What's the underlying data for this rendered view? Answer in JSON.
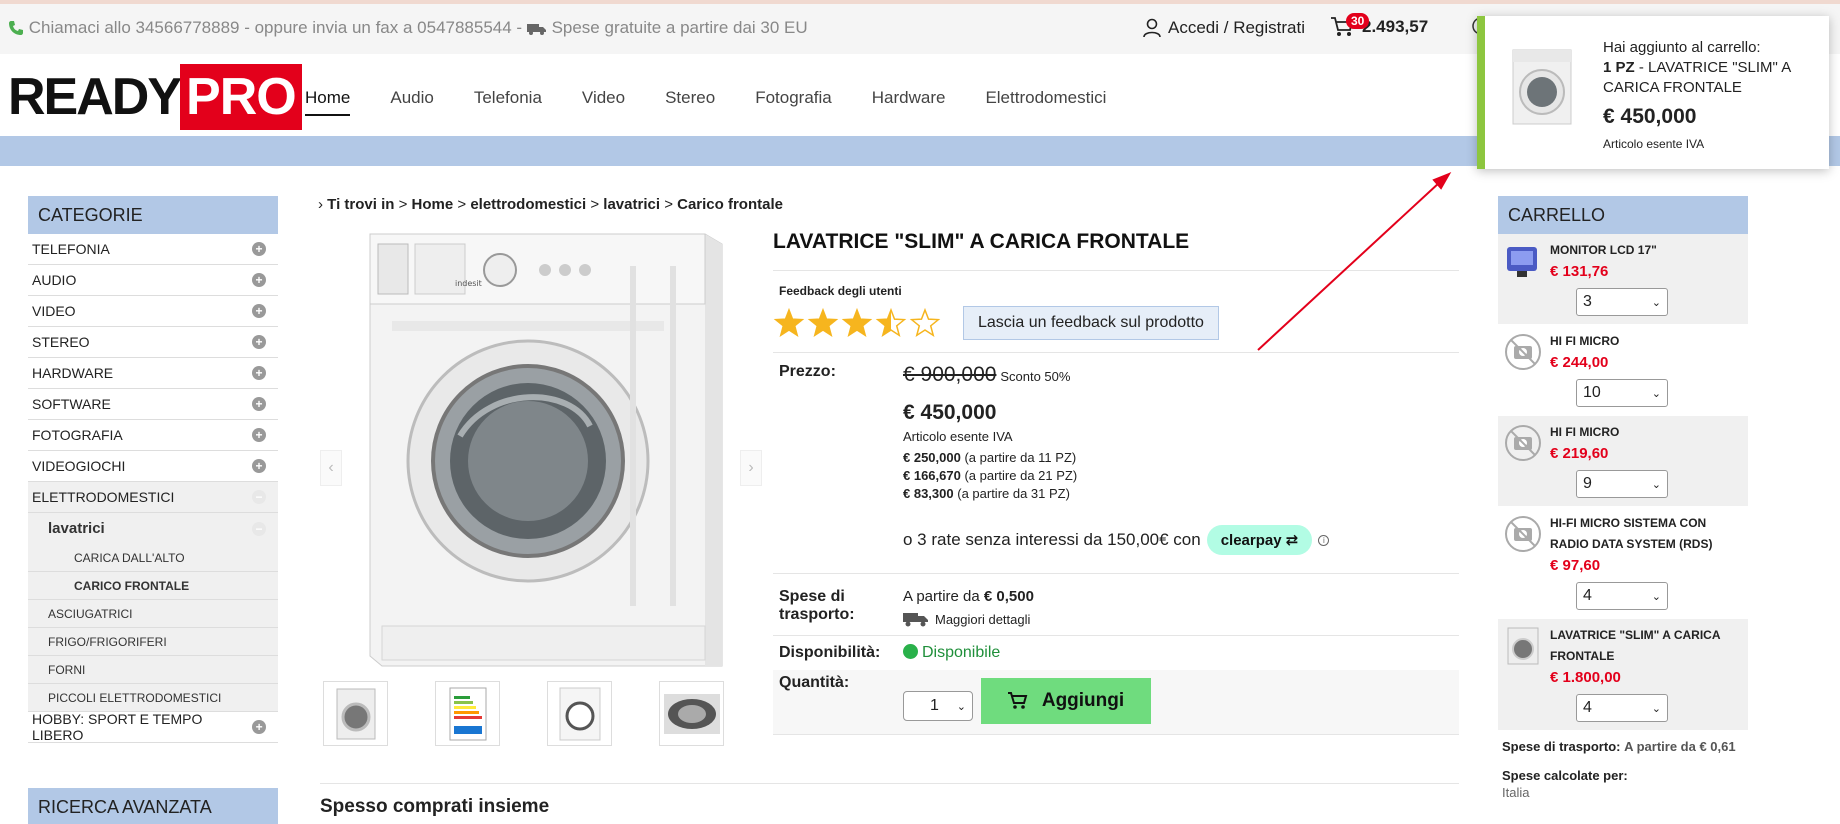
{
  "topbar": {
    "contact": "Chiamaci allo 34566778889 - oppure invia un fax a 0547885544 -",
    "shipping_free": "Spese gratuite a partire dai 30 EU",
    "login": "Accedi / Registrati",
    "cart_count": "30",
    "cart_total": "2.493,57"
  },
  "logo": {
    "part1": "READY",
    "part2": "PRO"
  },
  "nav": [
    "Home",
    "Audio",
    "Telefonia",
    "Video",
    "Stereo",
    "Fotografia",
    "Hardware",
    "Elettrodomestici"
  ],
  "categories": {
    "title": "CATEGORIE",
    "items": [
      "TELEFONIA",
      "AUDIO",
      "VIDEO",
      "STEREO",
      "HARDWARE",
      "SOFTWARE",
      "FOTOGRAFIA",
      "VIDEOGIOCHI"
    ],
    "open_item": "ELETTRODOMESTICI",
    "sub_open": "lavatrici",
    "sub_sub": [
      "CARICA DALL'ALTO",
      "CARICO FRONTALE"
    ],
    "sub_items": [
      "ASCIUGATRICI",
      "FRIGO/FRIGORIFERI",
      "FORNI",
      "PICCOLI ELETTRODOMESTICI"
    ],
    "last_item": "HOBBY: SPORT E TEMPO LIBERO"
  },
  "advanced_search": {
    "title": "RICERCA AVANZATA"
  },
  "breadcrumb": {
    "prefix": "Ti trovi in",
    "items": [
      "Home",
      "elettrodomestici",
      "lavatrici",
      "Carico frontale"
    ]
  },
  "product": {
    "title": "LAVATRICE \"SLIM\" A CARICA FRONTALE",
    "feedback_label": "Feedback degli utenti",
    "rating": 3.5,
    "feedback_button": "Lascia un feedback sul prodotto",
    "price_label": "Prezzo:",
    "old_price": "€ 900,000",
    "discount": "Sconto 50%",
    "price": "€ 450,000",
    "vat_note": "Articolo esente IVA",
    "tiers": [
      {
        "price": "€ 250,000",
        "note": "(a partire da 11 PZ)"
      },
      {
        "price": "€ 166,670",
        "note": "(a partire da 21 PZ)"
      },
      {
        "price": "€ 83,300",
        "note": "(a partire da 31 PZ)"
      }
    ],
    "clearpay_text": "o 3 rate senza interessi da 150,00€ con",
    "clearpay_brand": "clearpay",
    "shipping_label": "Spese di trasporto:",
    "shipping_prefix": "A partire da",
    "shipping_value": "€ 0,500",
    "shipping_details": "Maggiori dettagli",
    "availability_label": "Disponibilità:",
    "availability_value": "Disponibile",
    "quantity_label": "Quantità:",
    "quantity_value": "1",
    "add_button": "Aggiungi"
  },
  "together_title": "Spesso comprati insieme",
  "cart": {
    "title": "CARRELLO",
    "items": [
      {
        "name": "MONITOR LCD 17\"",
        "price": "€ 131,76",
        "qty": "3"
      },
      {
        "name": "HI FI MICRO",
        "price": "€ 244,00",
        "qty": "10"
      },
      {
        "name": "HI FI MICRO",
        "price": "€ 219,60",
        "qty": "9"
      },
      {
        "name": "HI-FI MICRO SISTEMA CON RADIO DATA SYSTEM (RDS)",
        "price": "€ 97,60",
        "qty": "4"
      },
      {
        "name": "LAVATRICE \"SLIM\" A CARICA FRONTALE",
        "price": "€ 1.800,00",
        "qty": "4"
      }
    ],
    "shipping_label": "Spese di trasporto:",
    "shipping_value": "A partire da € 0,61",
    "calc_label": "Spese calcolate per:",
    "calc_value": "Italia"
  },
  "toast": {
    "heading": "Hai aggiunto al carrello:",
    "qty": "1 PZ",
    "name": " - LAVATRICE \"SLIM\" A CARICA FRONTALE",
    "price": "€ 450,000",
    "note": "Articolo esente IVA"
  },
  "colors": {
    "accent_blue": "#b2c8e6",
    "brand_red": "#e3001b",
    "add_green": "#6fdc7e",
    "toast_green": "#8dc63f"
  }
}
